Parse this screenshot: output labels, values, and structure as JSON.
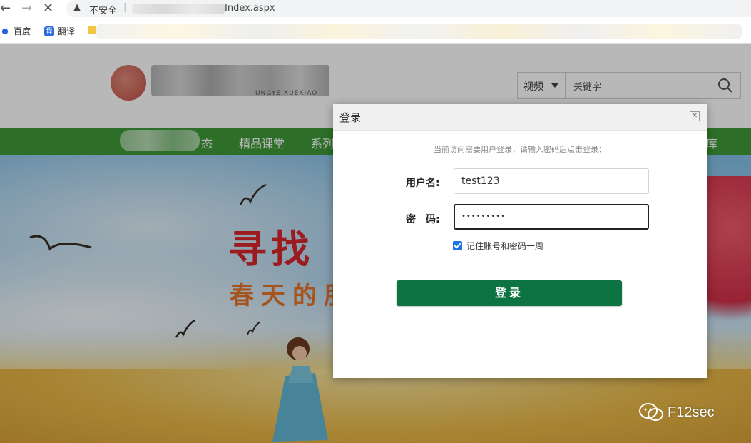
{
  "browser": {
    "security_label": "不安全",
    "url_suffix": "Index.aspx",
    "bookmarks": [
      {
        "label": "百度",
        "icon": "baidu-paw-icon"
      },
      {
        "label": "翻译",
        "icon": "translate-icon"
      }
    ]
  },
  "site": {
    "logo_subtitle": "UNGYE XUEXIAO",
    "search": {
      "category": "视频",
      "placeholder": "关键字"
    },
    "nav": {
      "items": [
        "态",
        "精品课堂",
        "系列",
        "库"
      ]
    },
    "banner": {
      "title_line1": "寻找",
      "title_line2": "春天的朋"
    }
  },
  "dialog": {
    "title": "登录",
    "close_symbol": "✕",
    "hint": "当前访问需要用户登录，请输入密码后点击登录：",
    "username_label": "用户名:",
    "username_value": "test123",
    "password_label": "密　码:",
    "password_value": "•••••••••",
    "remember_label": "记住账号和密码一周",
    "remember_checked": true,
    "submit_label": "登录"
  },
  "watermark": {
    "text": "F12sec"
  },
  "colors": {
    "nav_green": "#3f9a3a",
    "login_button": "#0e7343",
    "checkbox": "#1a73e8"
  }
}
